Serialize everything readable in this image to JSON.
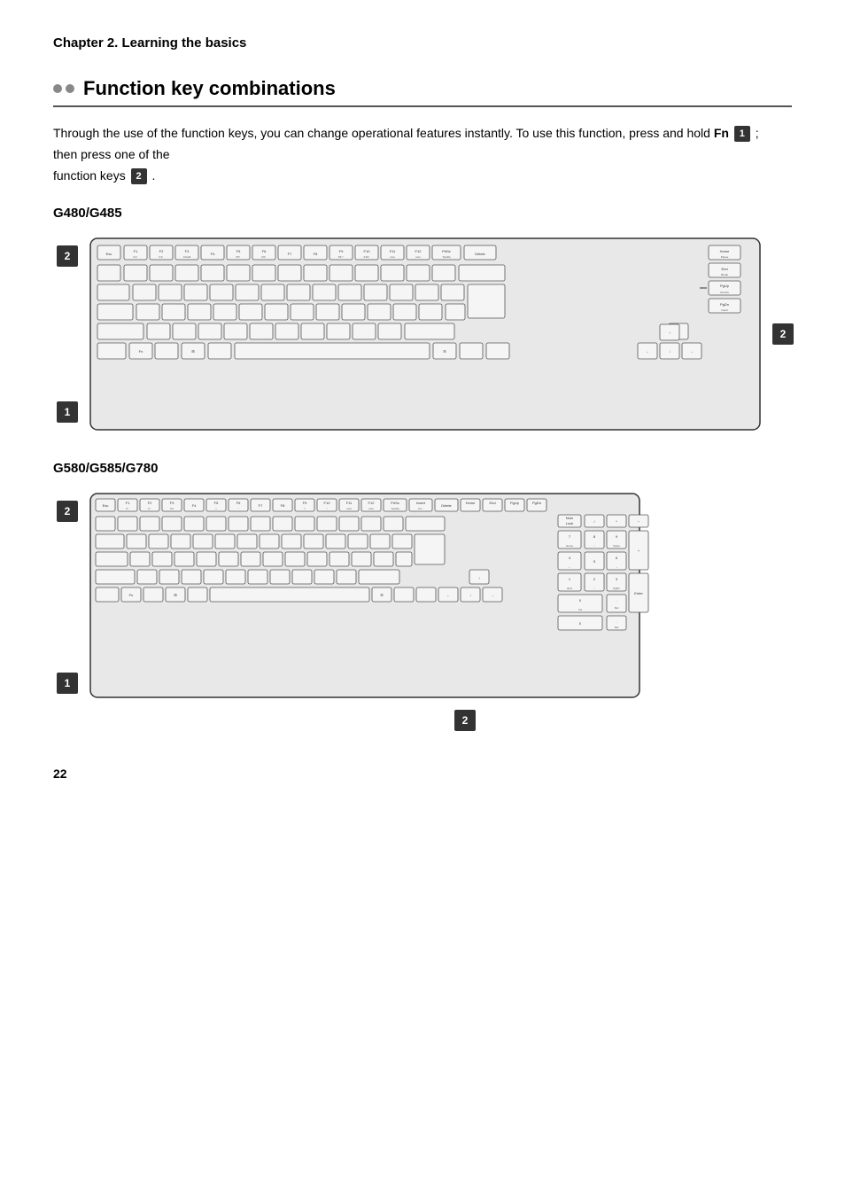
{
  "chapter": {
    "title": "Chapter 2. Learning the basics"
  },
  "section": {
    "title": "Function key combinations",
    "dots_count": 2,
    "intro": "Through the use of the function keys, you can change operational features instantly. To use this function, press and hold",
    "fn_label": "Fn",
    "badge1": "1",
    "mid_text": "; then press one of the",
    "end_text": "function keys",
    "badge2": "2",
    "period": "."
  },
  "keyboards": [
    {
      "id": "g480",
      "label": "G480/G485",
      "badge_1_label": "1",
      "badge_2_label": "2"
    },
    {
      "id": "g580",
      "label": "G580/G585/G780",
      "badge_1_label": "1",
      "badge_2_label": "2"
    }
  ],
  "page_number": "22"
}
